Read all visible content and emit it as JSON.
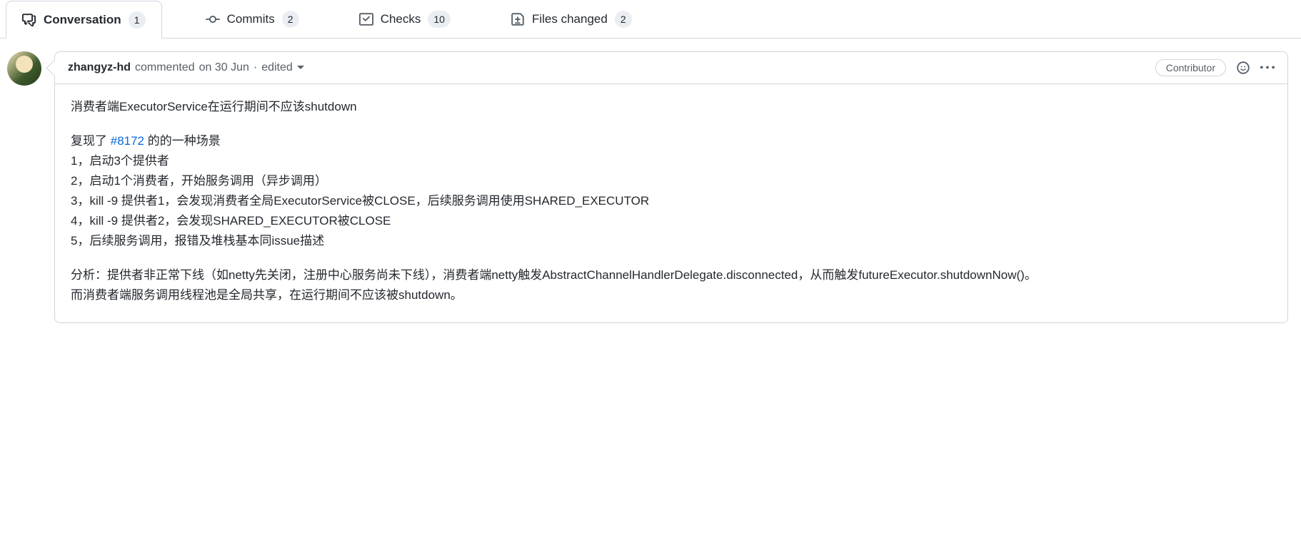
{
  "tabs": {
    "conversation": {
      "label": "Conversation",
      "count": "1"
    },
    "commits": {
      "label": "Commits",
      "count": "2"
    },
    "checks": {
      "label": "Checks",
      "count": "10"
    },
    "files_changed": {
      "label": "Files changed",
      "count": "2"
    }
  },
  "comment": {
    "author": "zhangyz-hd",
    "commented_prefix": "commented ",
    "timestamp": "on 30 Jun",
    "separator": " · ",
    "edited": "edited",
    "role_badge": "Contributor",
    "body": {
      "p1": "消费者端ExecutorService在运行期间不应该shutdown",
      "p2_pre": "复现了 ",
      "issue_ref": "#8172",
      "p2_post": " 的的一种场景\n1，启动3个提供者\n2，启动1个消费者，开始服务调用（异步调用）\n3，kill -9 提供者1，会发现消费者全局ExecutorService被CLOSE，后续服务调用使用SHARED_EXECUTOR\n4，kill -9 提供者2，会发现SHARED_EXECUTOR被CLOSE\n5，后续服务调用，报错及堆栈基本同issue描述",
      "p3": "分析：提供者非正常下线（如netty先关闭，注册中心服务尚未下线），消费者端netty触发AbstractChannelHandlerDelegate.disconnected，从而触发futureExecutor.shutdownNow()。\n而消费者端服务调用线程池是全局共享，在运行期间不应该被shutdown。"
    }
  }
}
